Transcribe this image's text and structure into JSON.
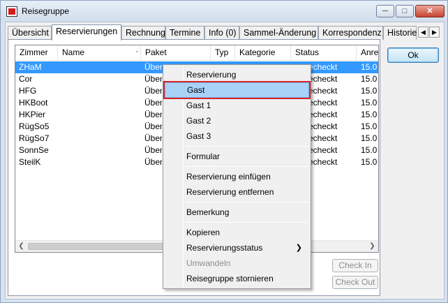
{
  "window": {
    "title": "Reisegruppe"
  },
  "tabs": [
    {
      "label": "Übersicht"
    },
    {
      "label": "Reservierungen"
    },
    {
      "label": "Rechnung"
    },
    {
      "label": "Termine"
    },
    {
      "label": "Info (0)"
    },
    {
      "label": "Sammel-Änderung"
    },
    {
      "label": "Korrespondenz"
    },
    {
      "label": "Historie"
    }
  ],
  "list": {
    "columns": [
      "Zimmer",
      "Name",
      "Paket",
      "Typ",
      "Kategorie",
      "Status",
      "Anrei"
    ],
    "rows": [
      {
        "zimmer": "ZHaM",
        "paket": "Überr",
        "status": "echeckt",
        "anreise": "15.0"
      },
      {
        "zimmer": "Cor",
        "paket": "Überr",
        "status": "echeckt",
        "anreise": "15.0"
      },
      {
        "zimmer": "HFG",
        "paket": "Überr",
        "status": "echeckt",
        "anreise": "15.0"
      },
      {
        "zimmer": "HKBoot",
        "paket": "Überr",
        "status": "echeckt",
        "anreise": "15.0"
      },
      {
        "zimmer": "HKPier",
        "paket": "Überr",
        "status": "echeckt",
        "anreise": "15.0"
      },
      {
        "zimmer": "RügSo5",
        "paket": "Überr",
        "status": "echeckt",
        "anreise": "15.0"
      },
      {
        "zimmer": "RügSo7",
        "paket": "Überr",
        "status": "echeckt",
        "anreise": "15.0"
      },
      {
        "zimmer": "SonnSe",
        "paket": "Überr",
        "status": "echeckt",
        "anreise": "15.0"
      },
      {
        "zimmer": "SteilK",
        "paket": "Überr",
        "status": "echeckt",
        "anreise": "15.0"
      }
    ]
  },
  "buttons": {
    "ok": "Ok",
    "check_in": "Check In",
    "check_out": "Check Out"
  },
  "context_menu": {
    "items": [
      {
        "label": "Reservierung"
      },
      {
        "label": "Gast"
      },
      {
        "label": "Gast 1"
      },
      {
        "label": "Gast 2"
      },
      {
        "label": "Gast 3"
      },
      {
        "label": "Formular"
      },
      {
        "label": "Reservierung einfügen"
      },
      {
        "label": "Reservierung entfernen"
      },
      {
        "label": "Bemerkung"
      },
      {
        "label": "Kopieren"
      },
      {
        "label": "Reservierungsstatus"
      },
      {
        "label": "Umwandeln"
      },
      {
        "label": "Reisegruppe stornieren"
      }
    ]
  },
  "icons": {
    "minimize": "minimize-icon",
    "maximize": "maximize-icon",
    "close": "close-icon",
    "scroll_left": "chevron-left-icon",
    "scroll_right": "chevron-right-icon",
    "submenu": "chevron-right-icon"
  },
  "colors": {
    "selection": "#3399ff",
    "menu_highlight": "#a9d2f8",
    "highlight_outline": "#d9232a"
  }
}
